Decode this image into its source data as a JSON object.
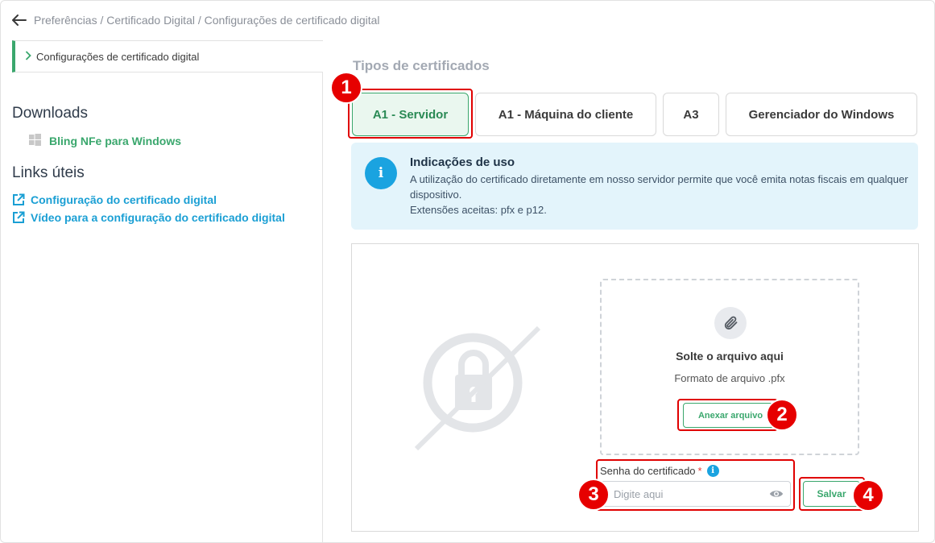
{
  "breadcrumb": "Preferências / Certificado Digital / Configurações de certificado digital",
  "sidebar": {
    "current_item": "Configurações de certificado digital",
    "downloads_heading": "Downloads",
    "download_link": "Bling NFe para Windows",
    "links_heading": "Links úteis",
    "links": [
      "Configuração do certificado digital",
      "Vídeo para a configuração do certificado digital"
    ]
  },
  "main": {
    "section_title": "Tipos de certificados",
    "tabs": [
      {
        "label": "A1 - Servidor",
        "active": true
      },
      {
        "label": "A1 - Máquina do cliente",
        "active": false
      },
      {
        "label": "A3",
        "active": false
      },
      {
        "label": "Gerenciador do Windows",
        "active": false
      }
    ],
    "info": {
      "icon_glyph": "i",
      "title": "Indicações de uso",
      "text_line1": "A utilização do certificado diretamente em nosso servidor permite que você emita notas fiscais em qualquer dispositivo.",
      "text_line2": "Extensões aceitas: pfx e p12."
    },
    "dropzone": {
      "title": "Solte o arquivo aqui",
      "format": "Formato de arquivo .pfx",
      "attach_label": "Anexar arquivo"
    },
    "password": {
      "label": "Senha do certificado",
      "required_mark": "*",
      "hint_glyph": "i",
      "placeholder": "Digite aqui",
      "value": ""
    },
    "save_label": "Salvar"
  },
  "annotations": [
    "1",
    "2",
    "3",
    "4"
  ],
  "colors": {
    "accent_green": "#3aa76d",
    "link_blue": "#1a9fd4",
    "info_bg": "#e3f4fb",
    "annotation_red": "#e60000"
  }
}
